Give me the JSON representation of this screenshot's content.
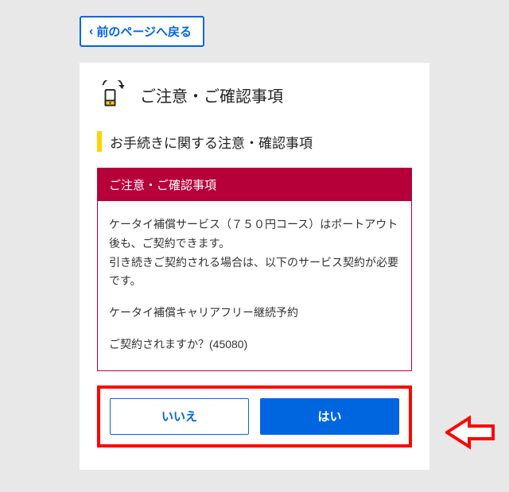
{
  "back_button": {
    "label": "前のページへ戻る"
  },
  "card": {
    "title": "ご注意・ご確認事項",
    "subhead": "お手続きに関する注意・確認事項"
  },
  "notice_box": {
    "header": "ご注意・ご確認事項",
    "p1": "ケータイ補償サービス（７５０円コース）はポートアウト後も、ご契約できます。",
    "p2": "引き続きご契約される場合は、以下のサービス契約が必要です。",
    "p3": "ケータイ補償キャリアフリー継続予約",
    "p4": "ご契約されますか？(45080)"
  },
  "buttons": {
    "no": "いいえ",
    "yes": "はい"
  }
}
